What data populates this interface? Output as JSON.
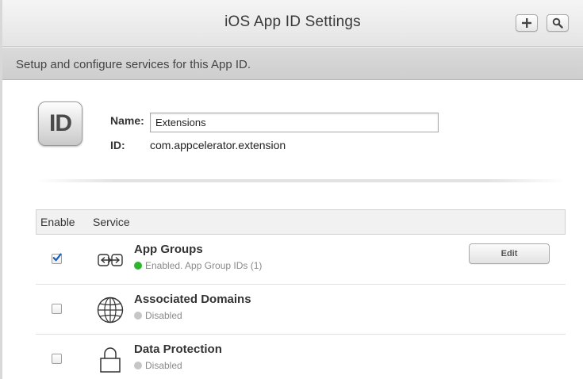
{
  "window": {
    "title": "iOS App ID Settings"
  },
  "toolbar": {
    "add_icon": "plus-icon",
    "search_icon": "search-icon"
  },
  "subheader": {
    "text": "Setup and configure services for this App ID."
  },
  "app_id": {
    "icon_text": "ID",
    "name_label": "Name:",
    "name_value": "Extensions",
    "id_label": "ID:",
    "id_value": "com.appcelerator.extension"
  },
  "table": {
    "headers": {
      "enable": "Enable",
      "service": "Service"
    },
    "rows": [
      {
        "name": "App Groups",
        "status": "Enabled. App Group IDs (1)",
        "enabled": true,
        "icon": "app-groups-icon",
        "status_color": "#2db52d",
        "action_label": "Edit"
      },
      {
        "name": "Associated Domains",
        "status": "Disabled",
        "enabled": false,
        "icon": "globe-icon",
        "status_color": "#c6c6c6"
      },
      {
        "name": "Data Protection",
        "status": "Disabled",
        "enabled": false,
        "icon": "lock-icon",
        "status_color": "#c6c6c6"
      }
    ]
  },
  "colors": {
    "enabled_dot": "#2db52d",
    "disabled_dot": "#c6c6c6",
    "checkmark": "#1d5fb8"
  }
}
